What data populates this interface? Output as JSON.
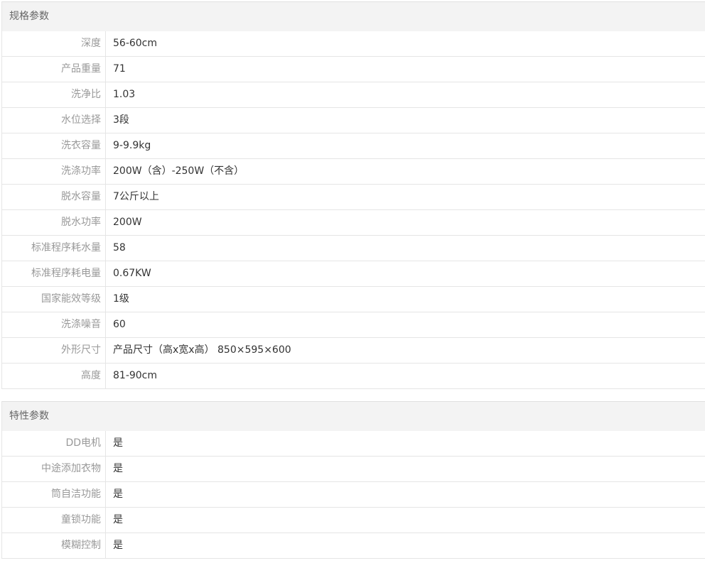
{
  "spec": {
    "title": "规格参数",
    "rows": [
      {
        "label": "深度",
        "value": "56-60cm"
      },
      {
        "label": "产品重量",
        "value": "71"
      },
      {
        "label": "洗净比",
        "value": "1.03"
      },
      {
        "label": "水位选择",
        "value": "3段"
      },
      {
        "label": "洗衣容量",
        "value": "9-9.9kg"
      },
      {
        "label": "洗涤功率",
        "value": "200W（含）-250W（不含）"
      },
      {
        "label": "脱水容量",
        "value": "7公斤以上"
      },
      {
        "label": "脱水功率",
        "value": "200W"
      },
      {
        "label": "标准程序耗水量",
        "value": "58"
      },
      {
        "label": "标准程序耗电量",
        "value": "0.67KW"
      },
      {
        "label": "国家能效等级",
        "value": "1级"
      },
      {
        "label": "洗涤噪音",
        "value": "60"
      },
      {
        "label": "外形尺寸",
        "value": "产品尺寸（高x宽x高） 850×595×600"
      },
      {
        "label": "高度",
        "value": "81-90cm"
      }
    ]
  },
  "feature": {
    "title": "特性参数",
    "rows": [
      {
        "label": "DD电机",
        "value": "是"
      },
      {
        "label": "中途添加衣物",
        "value": "是"
      },
      {
        "label": "筒自洁功能",
        "value": "是"
      },
      {
        "label": "童锁功能",
        "value": "是"
      },
      {
        "label": "模糊控制",
        "value": "是"
      }
    ]
  }
}
